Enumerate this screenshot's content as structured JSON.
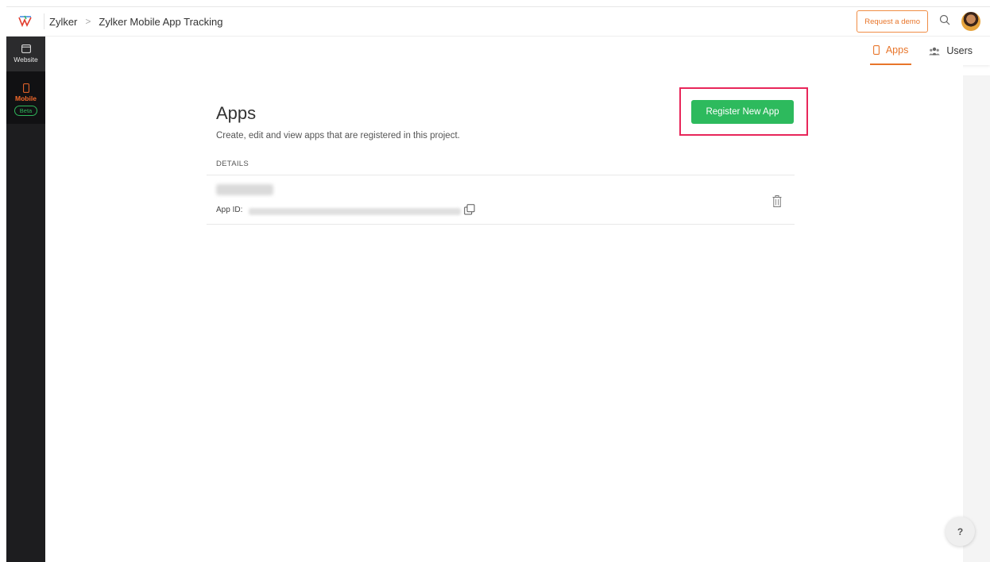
{
  "breadcrumb": {
    "org": "Zylker",
    "separator": ">",
    "project": "Zylker Mobile App Tracking"
  },
  "header": {
    "request_demo": "Request a demo"
  },
  "sidebar": {
    "items": [
      {
        "label": "Website"
      },
      {
        "label": "Mobile",
        "badge": "Beta"
      }
    ]
  },
  "tabs": [
    {
      "label": "Apps",
      "active": true
    },
    {
      "label": "Users",
      "active": false
    }
  ],
  "main": {
    "title": "Apps",
    "subtitle": "Create, edit and view apps that are registered in this project.",
    "details_header": "DETAILS",
    "register_button": "Register New App",
    "app_row": {
      "app_id_label": "App ID:"
    }
  },
  "help": {
    "label": "?"
  },
  "colors": {
    "accent": "#e8752a",
    "green": "#2dba5d",
    "highlight": "#e8265a"
  }
}
